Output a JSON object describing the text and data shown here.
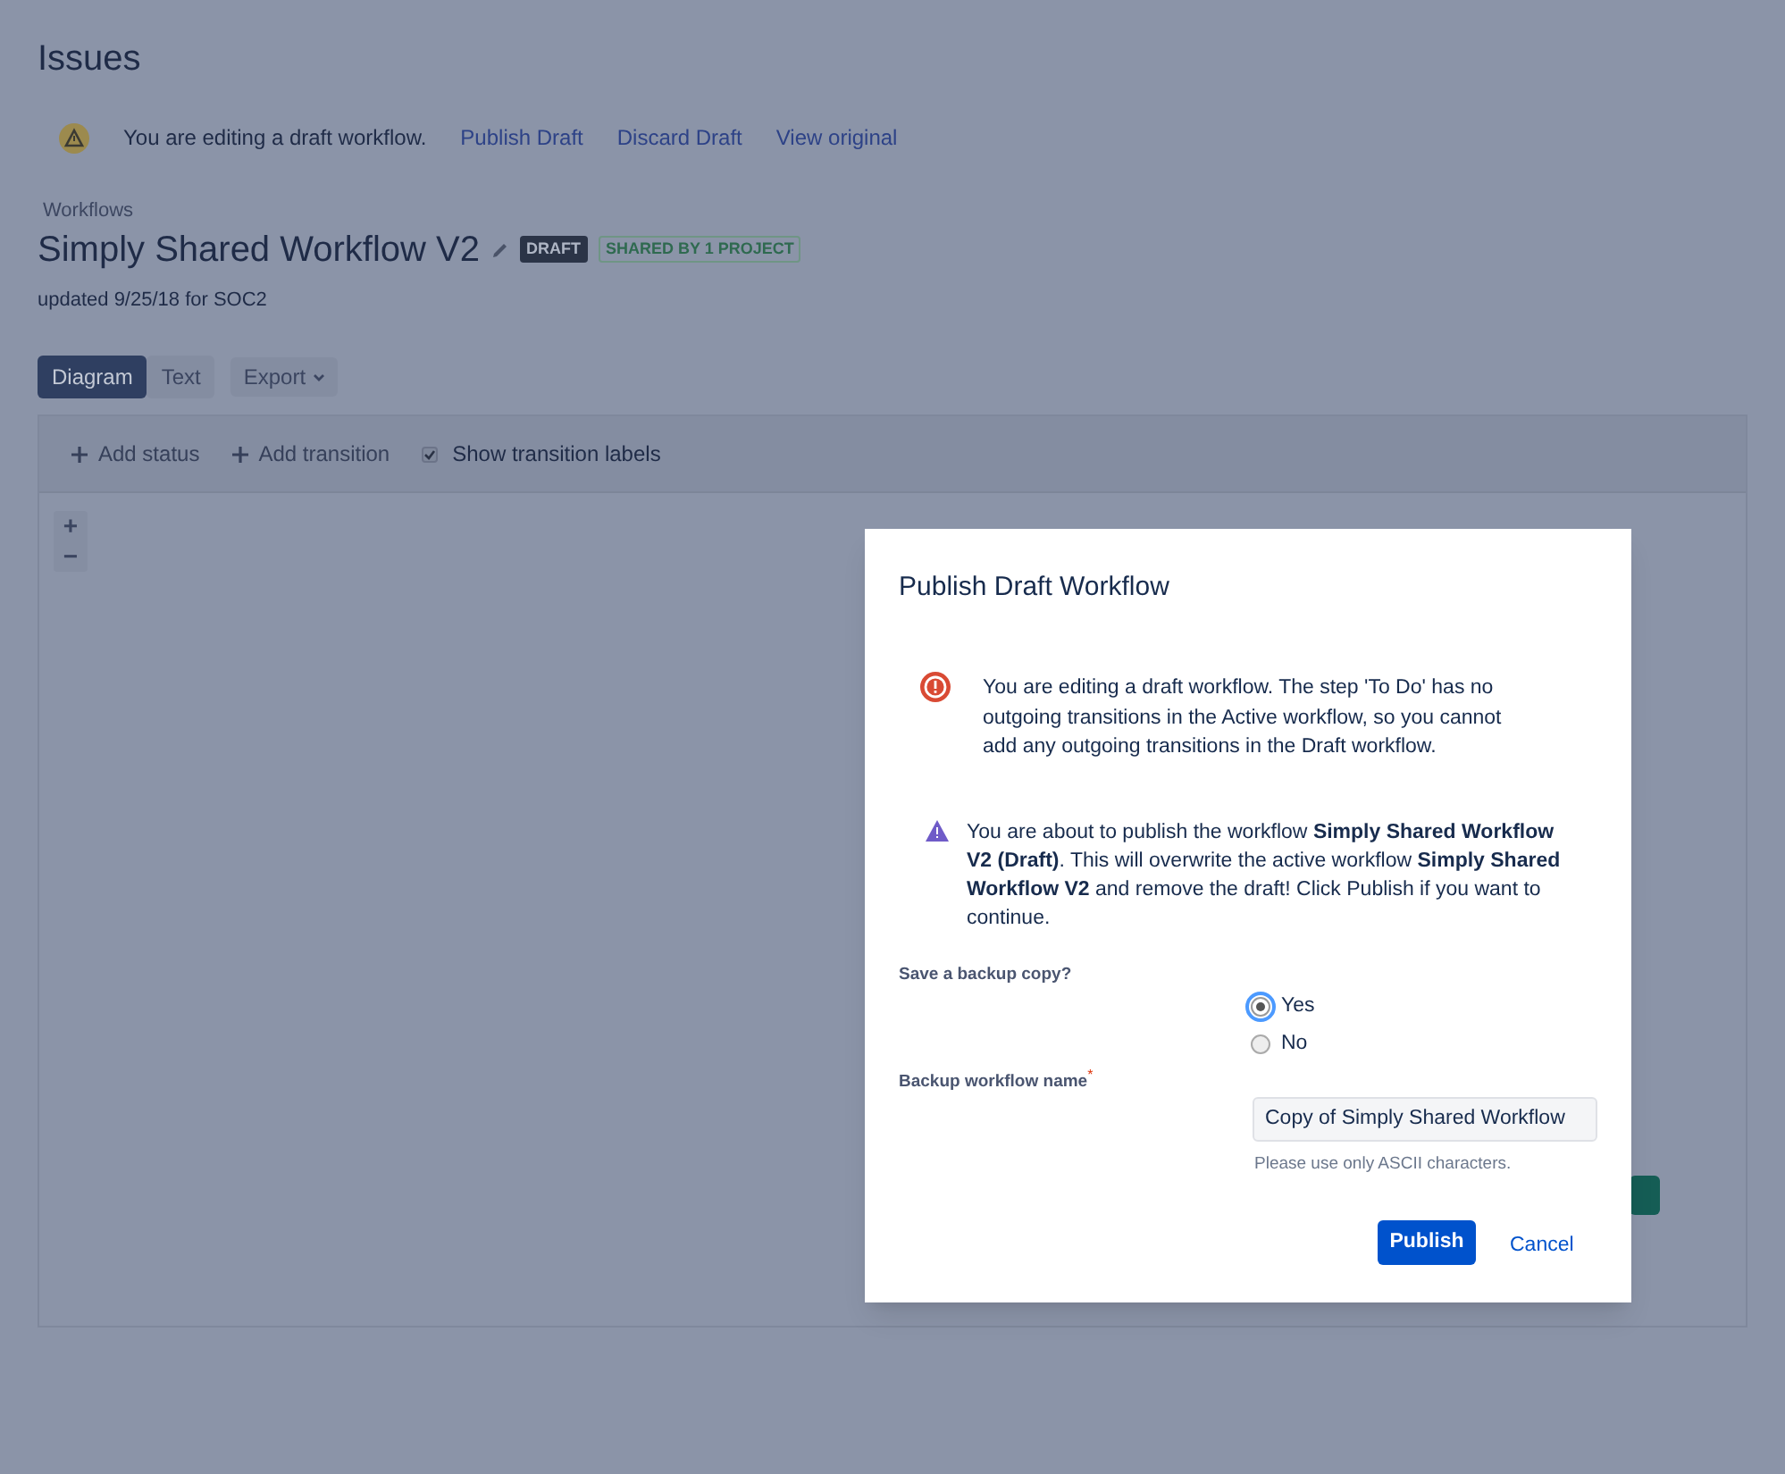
{
  "page_title": "Issues",
  "draft_banner": {
    "message": "You are editing a draft workflow.",
    "links": [
      "Publish Draft",
      "Discard Draft",
      "View original"
    ]
  },
  "breadcrumb": "Workflows",
  "workflow": {
    "title": "Simply Shared Workflow V2",
    "status_badge": "DRAFT",
    "shared_badge": "SHARED BY 1 PROJECT",
    "updated": "updated 9/25/18 for SOC2"
  },
  "view_tabs": [
    {
      "label": "Diagram",
      "selected": true
    },
    {
      "label": "Text",
      "selected": false
    }
  ],
  "export_menu": "Export",
  "toolbar": {
    "add_status": "Add status",
    "add_transition": "Add transition",
    "show_labels": {
      "label": "Show transition labels",
      "checked": true
    }
  },
  "zoom_controls": [
    "+",
    "−"
  ],
  "dialog": {
    "title": "Publish Draft Workflow",
    "error_message": "You are editing a draft workflow. The step 'To Do' has no outgoing transitions in the Active workflow, so you cannot add any outgoing transitions in the Draft workflow.",
    "warning_message": "You are about to publish the workflow **Simply Shared Workflow V2 (Draft)**. This will overwrite the active workflow **Simply Shared Workflow V2** and remove the draft! Click Publish if you want to continue.",
    "backup_question": "Save a backup copy?",
    "options": [
      {
        "label": "Yes",
        "selected": true
      },
      {
        "label": "No",
        "selected": false
      }
    ],
    "name_label": "Backup workflow name",
    "required_mark": "*",
    "name_value": "Copy of Simply Shared Workflow",
    "hint": "Please use only ASCII characters.",
    "publish": "Publish",
    "cancel": "Cancel"
  }
}
